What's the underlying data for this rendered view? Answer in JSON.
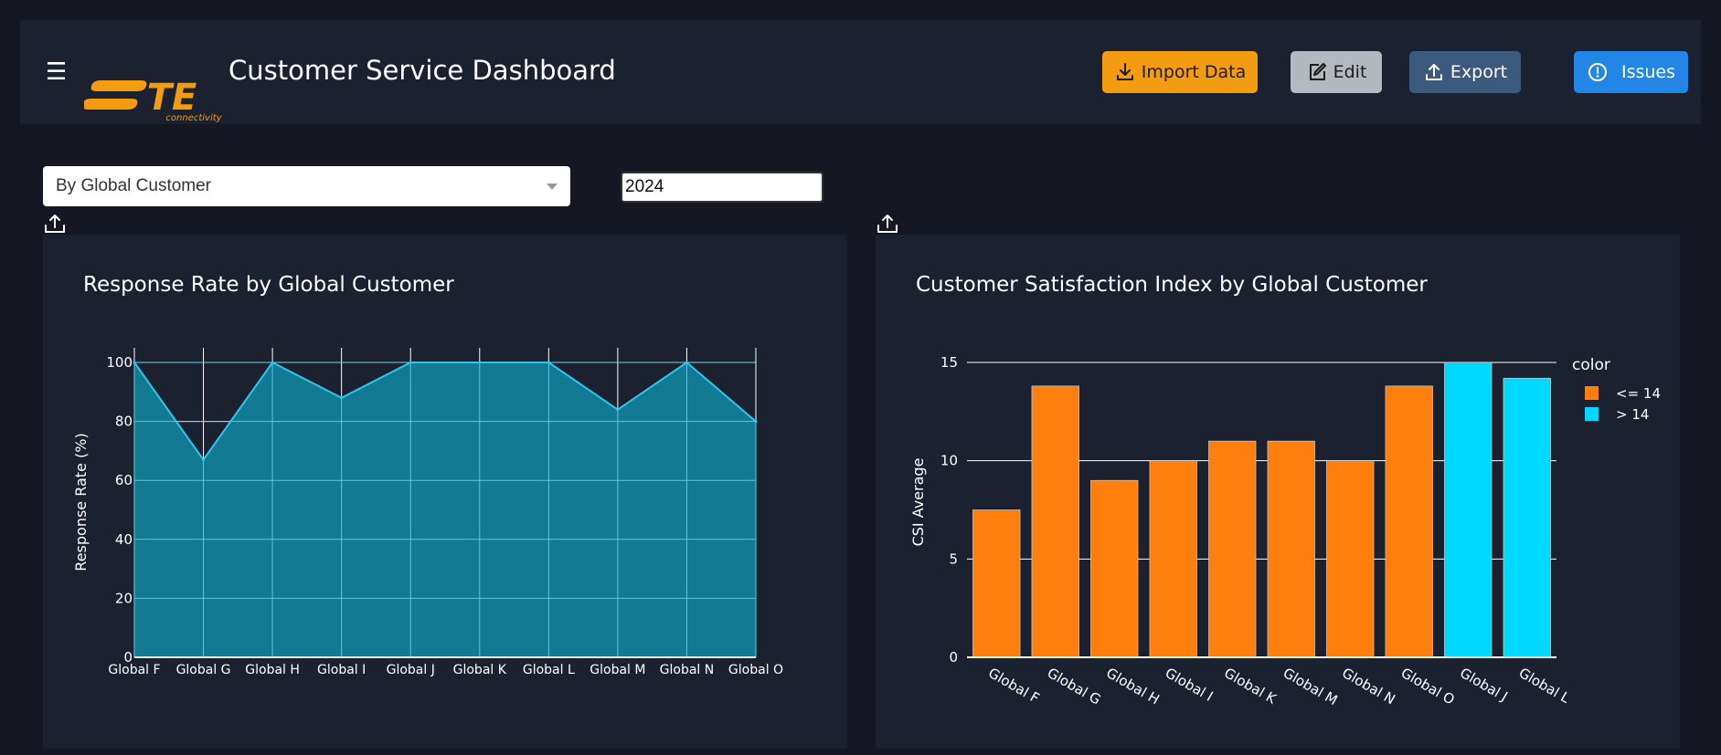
{
  "header": {
    "title": "Customer Service Dashboard",
    "logo_text": "TE",
    "logo_subtext": "connectivity",
    "menu_icon": "hamburger-icon",
    "buttons": {
      "import": "Import Data",
      "edit": "Edit",
      "export": "Export",
      "issues": "Issues"
    }
  },
  "filters": {
    "group_by": "By Global Customer",
    "year": "2024"
  },
  "colors": {
    "accent_orange": "#ff7f0e",
    "accent_cyan": "#00d8ff",
    "area_fill": "#127a93",
    "area_line": "#2ec7eb"
  },
  "chart_data": [
    {
      "type": "area",
      "title": "Response Rate by Global Customer",
      "xlabel": "",
      "ylabel": "Response Rate (%)",
      "categories": [
        "Global F",
        "Global G",
        "Global H",
        "Global I",
        "Global J",
        "Global K",
        "Global L",
        "Global M",
        "Global N",
        "Global O"
      ],
      "values": [
        100,
        67,
        100,
        88,
        100,
        100,
        100,
        84,
        100,
        80
      ],
      "ylim": [
        0,
        100
      ],
      "yticks": [
        0,
        20,
        40,
        60,
        80,
        100
      ],
      "grid": true
    },
    {
      "type": "bar",
      "title": "Customer Satisfaction Index by Global Customer",
      "xlabel": "",
      "ylabel": "CSI Average",
      "categories": [
        "Global F",
        "Global G",
        "Global H",
        "Global I",
        "Global K",
        "Global M",
        "Global N",
        "Global O",
        "Global J",
        "Global L"
      ],
      "values": [
        7.5,
        13.8,
        9,
        10,
        11,
        11,
        10,
        13.8,
        15,
        14.2
      ],
      "groups": [
        "<= 14",
        "<= 14",
        "<= 14",
        "<= 14",
        "<= 14",
        "<= 14",
        "<= 14",
        "<= 14",
        "> 14",
        "> 14"
      ],
      "ylim": [
        0,
        15
      ],
      "yticks": [
        0,
        5,
        10,
        15
      ],
      "legend": {
        "title": "color",
        "placement": "right",
        "entries": [
          {
            "name": "<= 14",
            "color": "#ff7f0e"
          },
          {
            "name": "> 14",
            "color": "#00d8ff"
          }
        ]
      },
      "grid": true
    }
  ]
}
